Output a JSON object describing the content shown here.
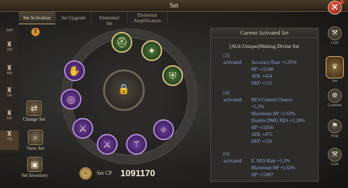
{
  "window": {
    "title": "Set"
  },
  "tabs": [
    {
      "label": "Set Activation",
      "active": true
    },
    {
      "label": "Set Upgrade",
      "active": false
    },
    {
      "label": "Elemental Set",
      "active": false
    },
    {
      "label": "Elemental Amplification",
      "active": false
    }
  ],
  "tiers": [
    {
      "label": "2nd"
    },
    {
      "label": "3rd"
    },
    {
      "label": "4th"
    },
    {
      "label": "5th"
    },
    {
      "label": "6th"
    },
    {
      "label": "7th"
    }
  ],
  "left_buttons": {
    "change_set": "Change Set",
    "view_set": "View Set",
    "set_inventory": "Set Inventory"
  },
  "cp": {
    "label": "Set CP",
    "value": "1091170"
  },
  "panel": {
    "title": "Current Activated Set",
    "set_name": "[AGI-Unique]Shining Divine Set",
    "bonuses": [
      {
        "tier": "[2]",
        "activated": "activated:",
        "stats": [
          "Accuracy Rate +1.95%",
          "HP +11340",
          "ATK +454",
          "DEF +152"
        ]
      },
      {
        "tier": "[4]",
        "activated": "activated:",
        "stats": [
          "RES Control Chance",
          "+5.2%",
          "Maximum HP +1.63%",
          "Double DMG RES +2.28%",
          "HP +11856",
          "ATK +475",
          "DEF +159"
        ]
      },
      {
        "tier": "[6]",
        "activated": "activated:",
        "stats": [
          "E. RES Rate +5.2%",
          "Maximum HP +1.63%",
          "HP +12887"
        ]
      }
    ]
  },
  "right_nav": [
    {
      "label": "Craft",
      "icon": "craft-icon"
    },
    {
      "label": "Set",
      "icon": "set-icon"
    },
    {
      "label": "Combine",
      "icon": "combine-icon"
    },
    {
      "label": "Flag",
      "icon": "flag-icon"
    },
    {
      "label": "Craft",
      "icon": "craft-icon"
    }
  ],
  "colors": {
    "accent": "#c9a66a",
    "stat_text": "#8fa9e0",
    "close": "#b8281c"
  }
}
